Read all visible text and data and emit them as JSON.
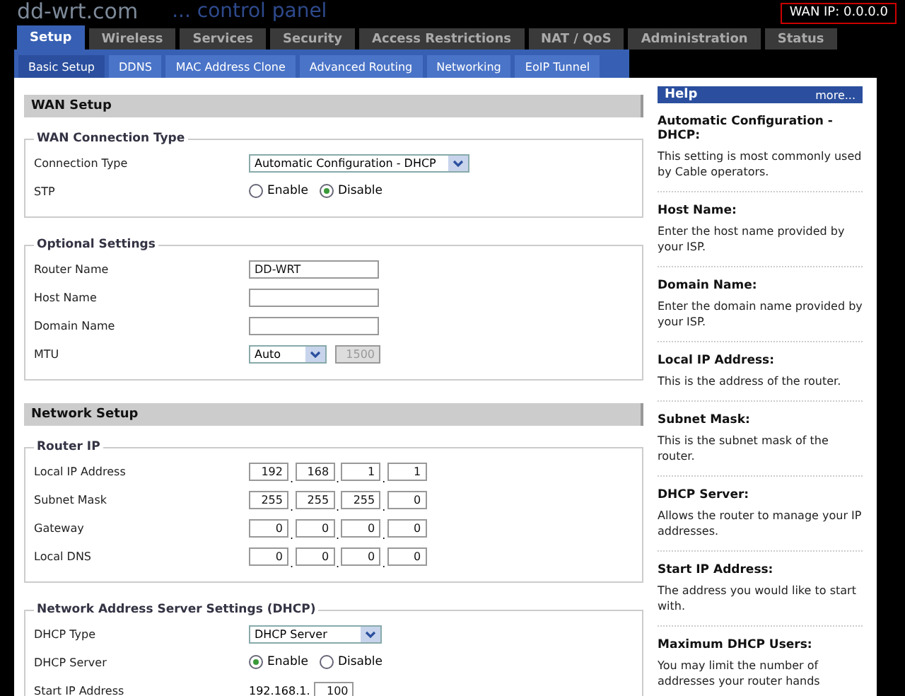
{
  "header": {
    "logo": "dd-wrt.com",
    "subtitle": "... control panel",
    "wan_ip": "WAN IP: 0.0.0.0"
  },
  "tabs": [
    {
      "label": "Setup",
      "selected": true
    },
    {
      "label": "Wireless",
      "selected": false
    },
    {
      "label": "Services",
      "selected": false
    },
    {
      "label": "Security",
      "selected": false
    },
    {
      "label": "Access Restrictions",
      "selected": false
    },
    {
      "label": "NAT / QoS",
      "selected": false
    },
    {
      "label": "Administration",
      "selected": false
    },
    {
      "label": "Status",
      "selected": false
    }
  ],
  "subtabs": [
    {
      "label": "Basic Setup",
      "selected": true
    },
    {
      "label": "DDNS",
      "selected": false
    },
    {
      "label": "MAC Address Clone",
      "selected": false
    },
    {
      "label": "Advanced Routing",
      "selected": false
    },
    {
      "label": "Networking",
      "selected": false
    },
    {
      "label": "EoIP Tunnel",
      "selected": false
    }
  ],
  "sections": [
    {
      "title": "WAN Setup",
      "groups": [
        {
          "legend": "WAN Connection Type",
          "rows": [
            {
              "kind": "select",
              "label": "Connection Type",
              "value": "Automatic Configuration - DHCP"
            },
            {
              "kind": "radio",
              "label": "STP",
              "options": [
                {
                  "label": "Enable",
                  "selected": false
                },
                {
                  "label": "Disable",
                  "selected": true
                }
              ]
            }
          ]
        },
        {
          "legend": "Optional Settings",
          "rows": [
            {
              "kind": "text",
              "label": "Router Name",
              "value": "DD-WRT"
            },
            {
              "kind": "text",
              "label": "Host Name"
            },
            {
              "kind": "text",
              "label": "Domain Name"
            },
            {
              "kind": "mtu",
              "label": "MTU",
              "value": "Auto",
              "extra": "1500"
            }
          ]
        }
      ]
    },
    {
      "title": "Network Setup",
      "groups": [
        {
          "legend": "Router IP",
          "rows": [
            {
              "kind": "ip",
              "label": "Local IP Address",
              "separator": ".",
              "octets": [
                "192",
                "168",
                "1",
                "1"
              ]
            },
            {
              "kind": "ip",
              "label": "Subnet Mask",
              "separator": ".",
              "octets": [
                "255",
                "255",
                "255",
                "0"
              ]
            },
            {
              "kind": "ip",
              "label": "Gateway",
              "separator": ".",
              "octets": [
                "0",
                "0",
                "0",
                "0"
              ]
            },
            {
              "kind": "ip",
              "label": "Local DNS",
              "separator": ".",
              "octets": [
                "0",
                "0",
                "0",
                "0"
              ]
            }
          ]
        },
        {
          "legend": "Network Address Server Settings (DHCP)",
          "rows": [
            {
              "kind": "select",
              "label": "DHCP Type",
              "value": "DHCP Server"
            },
            {
              "kind": "radio",
              "label": "DHCP Server",
              "options": [
                {
                  "label": "Enable",
                  "selected": true
                },
                {
                  "label": "Disable",
                  "selected": false
                }
              ]
            },
            {
              "kind": "prefix",
              "label": "Start IP Address",
              "prefix": "192.168.1.",
              "value": "100"
            }
          ]
        }
      ]
    }
  ],
  "help": {
    "title": "Help",
    "more": "more...",
    "items": [
      {
        "heading": "Automatic Configuration - DHCP:",
        "text": "This setting is most commonly used by Cable operators."
      },
      {
        "heading": "Host Name:",
        "text": "Enter the host name provided by your ISP."
      },
      {
        "heading": "Domain Name:",
        "text": "Enter the domain name provided by your ISP."
      },
      {
        "heading": "Local IP Address:",
        "text": "This is the address of the router."
      },
      {
        "heading": "Subnet Mask:",
        "text": "This is the subnet mask of the router."
      },
      {
        "heading": "DHCP Server:",
        "text": "Allows the router to manage your IP addresses."
      },
      {
        "heading": "Start IP Address:",
        "text": "The address you would like to start with."
      },
      {
        "heading": "Maximum DHCP Users:",
        "text": "You may limit the number of addresses your router hands"
      }
    ]
  }
}
